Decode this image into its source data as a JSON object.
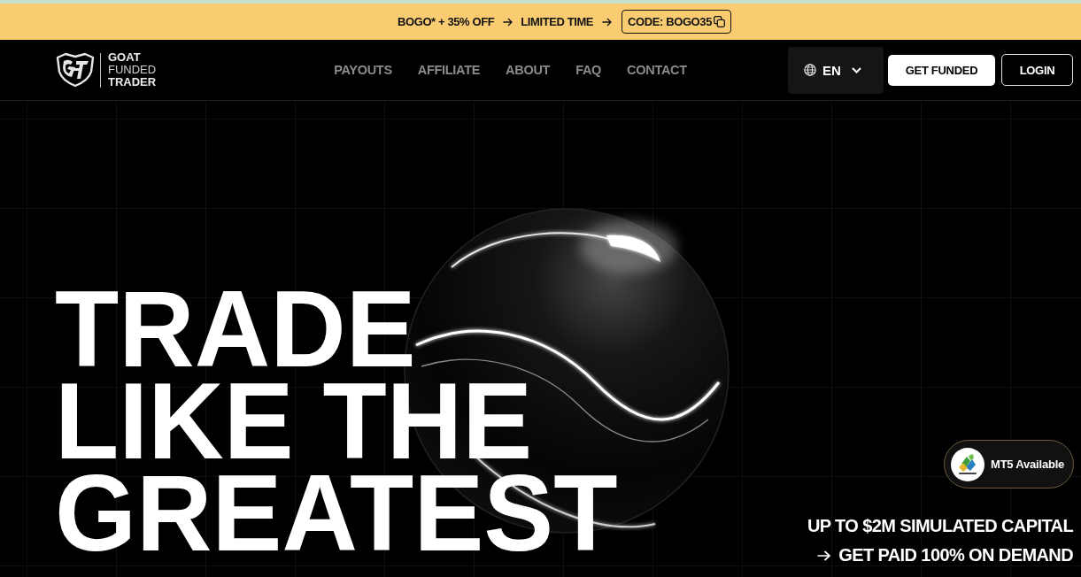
{
  "promo_banner": {
    "items": [
      {
        "text": "BOGO* + 35% OFF",
        "arrow_after": true
      },
      {
        "text": "LIMITED TIME",
        "arrow_after": true
      }
    ],
    "code": {
      "label": "CODE: BOGO35"
    }
  },
  "header": {
    "logo": {
      "lines": [
        {
          "text": "GOAT",
          "kind": "bold"
        },
        {
          "text": "FUNDED",
          "kind": "light"
        },
        {
          "text": "TRADER",
          "kind": "bold"
        }
      ]
    },
    "nav": [
      {
        "label": "PAYOUTS"
      },
      {
        "label": "AFFILIATE"
      },
      {
        "label": "ABOUT"
      },
      {
        "label": "FAQ"
      },
      {
        "label": "CONTACT"
      }
    ],
    "language": {
      "label": "EN"
    },
    "buttons": [
      {
        "label": "GET FUNDED",
        "kind": "primary"
      },
      {
        "label": "LOGIN",
        "kind": "outline"
      }
    ]
  },
  "hero": {
    "heading_lines": [
      "TRADE",
      "LIKE THE",
      "GREATEST"
    ],
    "mt5_badge": {
      "label": "MT5 Available"
    },
    "taglines": [
      {
        "text": "UP TO $2M SIMULATED CAPITAL",
        "arrow": false
      },
      {
        "text": "GET PAID 100% ON DEMAND",
        "arrow": true
      }
    ]
  }
}
